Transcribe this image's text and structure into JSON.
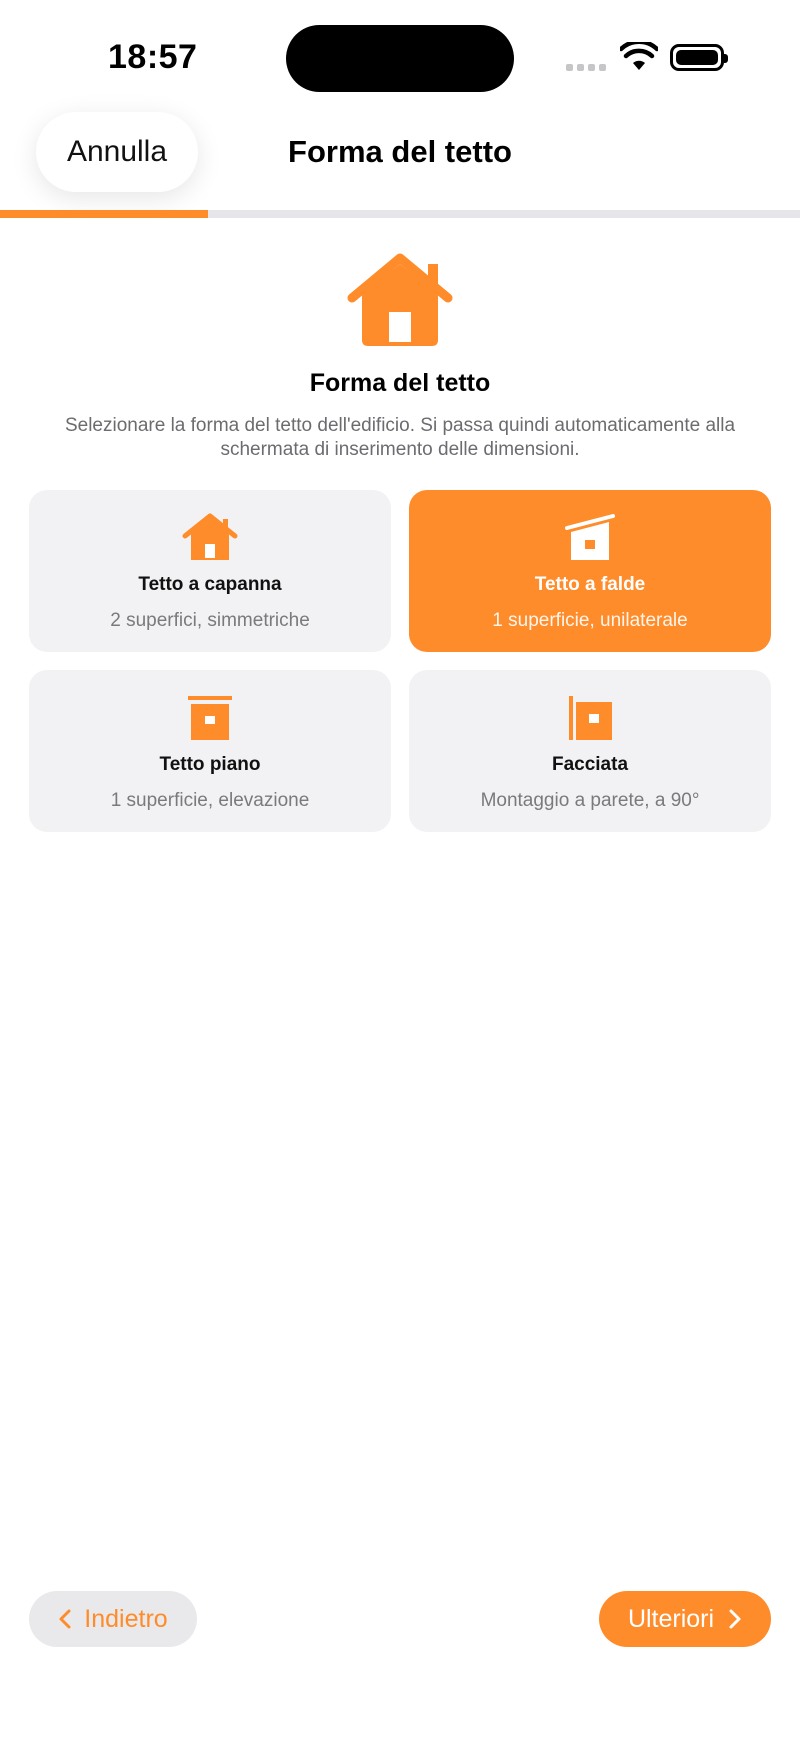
{
  "status_bar": {
    "time": "18:57"
  },
  "nav": {
    "cancel_label": "Annulla",
    "title": "Forma del tetto"
  },
  "progress": {
    "value": 0.26,
    "accent": "#ff8c2b"
  },
  "header": {
    "icon": "house-icon",
    "title": "Forma del tetto",
    "description": "Selezionare la forma del tetto dell'edificio. Si passa quindi automaticamente alla schermata di inserimento delle dimensioni."
  },
  "roof_options": [
    {
      "title": "Tetto a capanna",
      "subtitle": "2 superfici, simmetriche",
      "icon": "gable-roof-icon",
      "selected": false
    },
    {
      "title": "Tetto a falde",
      "subtitle": "1 superficie, unilaterale",
      "icon": "shed-roof-icon",
      "selected": true
    },
    {
      "title": "Tetto piano",
      "subtitle": "1 superficie, elevazione",
      "icon": "flat-roof-icon",
      "selected": false
    },
    {
      "title": "Facciata",
      "subtitle": "Montaggio a parete, a 90°",
      "icon": "facade-icon",
      "selected": false
    }
  ],
  "footer": {
    "back_label": "Indietro",
    "next_label": "Ulteriori"
  },
  "colors": {
    "accent": "#ff8c2b",
    "card_bg": "#f2f2f4",
    "secondary_text": "#7a7a7e"
  }
}
